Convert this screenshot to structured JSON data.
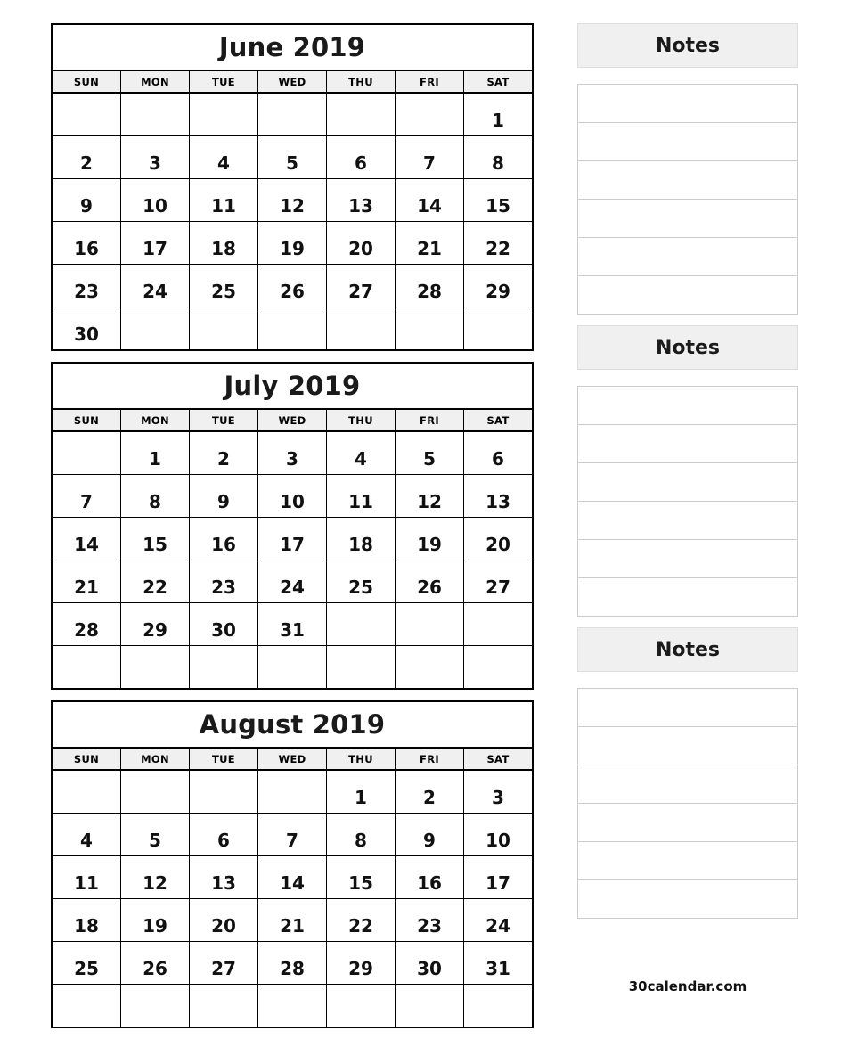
{
  "colors": {
    "grid_line": "#000000",
    "header_fill": "#f0f0f0",
    "notes_rule": "#cccccc",
    "text": "#111111"
  },
  "weekdays": [
    "SUN",
    "MON",
    "TUE",
    "WED",
    "THU",
    "FRI",
    "SAT"
  ],
  "months": [
    {
      "title": "June 2019",
      "weeks": [
        [
          "",
          "",
          "",
          "",
          "",
          "",
          "1"
        ],
        [
          "2",
          "3",
          "4",
          "5",
          "6",
          "7",
          "8"
        ],
        [
          "9",
          "10",
          "11",
          "12",
          "13",
          "14",
          "15"
        ],
        [
          "16",
          "17",
          "18",
          "19",
          "20",
          "21",
          "22"
        ],
        [
          "23",
          "24",
          "25",
          "26",
          "27",
          "28",
          "29"
        ],
        [
          "30",
          "",
          "",
          "",
          "",
          "",
          ""
        ]
      ]
    },
    {
      "title": "July 2019",
      "weeks": [
        [
          "",
          "1",
          "2",
          "3",
          "4",
          "5",
          "6"
        ],
        [
          "7",
          "8",
          "9",
          "10",
          "11",
          "12",
          "13"
        ],
        [
          "14",
          "15",
          "16",
          "17",
          "18",
          "19",
          "20"
        ],
        [
          "21",
          "22",
          "23",
          "24",
          "25",
          "26",
          "27"
        ],
        [
          "28",
          "29",
          "30",
          "31",
          "",
          "",
          ""
        ],
        [
          "",
          "",
          "",
          "",
          "",
          "",
          ""
        ]
      ]
    },
    {
      "title": "August 2019",
      "weeks": [
        [
          "",
          "",
          "",
          "",
          "1",
          "2",
          "3"
        ],
        [
          "4",
          "5",
          "6",
          "7",
          "8",
          "9",
          "10"
        ],
        [
          "11",
          "12",
          "13",
          "14",
          "15",
          "16",
          "17"
        ],
        [
          "18",
          "19",
          "20",
          "21",
          "22",
          "23",
          "24"
        ],
        [
          "25",
          "26",
          "27",
          "28",
          "29",
          "30",
          "31"
        ],
        [
          "",
          "",
          "",
          "",
          "",
          "",
          ""
        ]
      ]
    }
  ],
  "notes_panels": [
    {
      "title": "Notes",
      "line_count": 6
    },
    {
      "title": "Notes",
      "line_count": 6
    },
    {
      "title": "Notes",
      "line_count": 6
    }
  ],
  "footer": {
    "site": "30calendar.com"
  }
}
